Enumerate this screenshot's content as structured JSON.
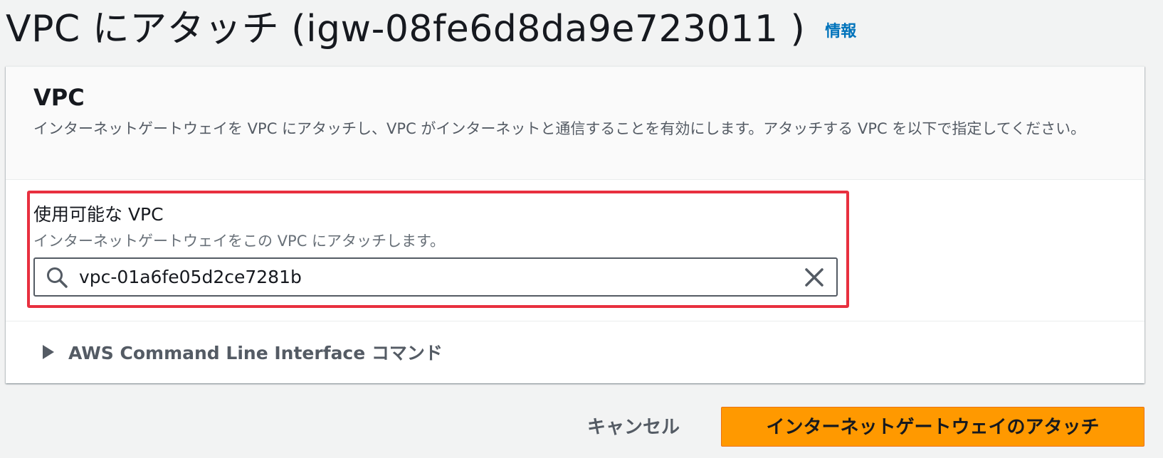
{
  "header": {
    "title": "VPC にアタッチ (igw-08fe6d8da9e723011 )",
    "info_link": "情報"
  },
  "panel": {
    "title": "VPC",
    "description": "インターネットゲートウェイを VPC にアタッチし、VPC がインターネットと通信することを有効にします。アタッチする VPC を以下で指定してください。"
  },
  "field": {
    "label": "使用可能な VPC",
    "description": "インターネットゲートウェイをこの VPC にアタッチします。",
    "value": "vpc-01a6fe05d2ce7281b",
    "search_icon": "search-icon",
    "clear_icon": "close-icon"
  },
  "cli": {
    "label": "AWS Command Line Interface コマンド",
    "icon": "caret-right-icon"
  },
  "footer": {
    "cancel_label": "キャンセル",
    "submit_label": "インターネットゲートウェイのアタッチ"
  },
  "colors": {
    "accent": "#ff9900",
    "link": "#0073bb",
    "highlight": "#e8303f"
  }
}
